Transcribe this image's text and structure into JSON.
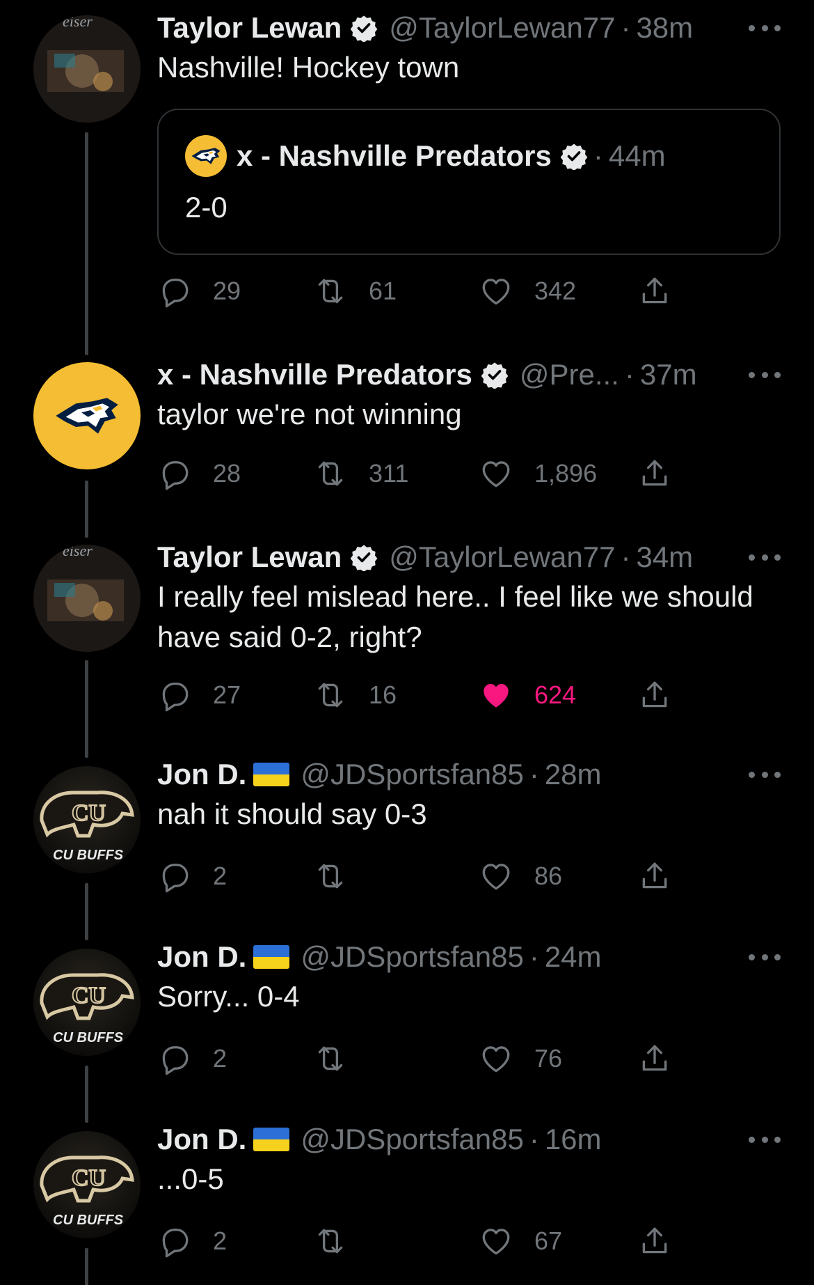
{
  "colors": {
    "background": "#000000",
    "text": "#e7e9ea",
    "muted": "#71767b",
    "like_active": "#f91880",
    "thread_line": "#3e4144",
    "verified": "#e7e9ea"
  },
  "tweets": [
    {
      "name": "Taylor Lewan",
      "handle": "@TaylorLewan77",
      "time": "38m",
      "text": "Nashville! Hockey town",
      "avatar_text": "eiser",
      "quote": {
        "name": "x - Nashville Predators",
        "time": "44m",
        "text": "2-0"
      },
      "replies": "29",
      "retweets": "61",
      "likes": "342",
      "liked": false
    },
    {
      "name": "x - Nashville Predators",
      "handle": "@Pre...",
      "time": "37m",
      "text": "taylor we're not winning",
      "replies": "28",
      "retweets": "311",
      "likes": "1,896",
      "liked": false
    },
    {
      "name": "Taylor Lewan",
      "handle": "@TaylorLewan77",
      "time": "34m",
      "text": "I really feel mislead here.. I feel like we should have said 0-2, right?",
      "avatar_text": "eiser",
      "replies": "27",
      "retweets": "16",
      "likes": "624",
      "liked": true
    },
    {
      "name": "Jon D.",
      "handle": "@JDSportsfan85",
      "time": "28m",
      "text": "nah it should say 0-3",
      "avatar_text": "CU BUFFS",
      "replies": "2",
      "retweets": "",
      "likes": "86",
      "liked": false
    },
    {
      "name": "Jon D.",
      "handle": "@JDSportsfan85",
      "time": "24m",
      "text": "Sorry... 0-4",
      "avatar_text": "CU BUFFS",
      "replies": "2",
      "retweets": "",
      "likes": "76",
      "liked": false
    },
    {
      "name": "Jon D.",
      "handle": "@JDSportsfan85",
      "time": "16m",
      "text": "...0-5",
      "avatar_text": "CU BUFFS",
      "replies": "2",
      "retweets": "",
      "likes": "67",
      "liked": false
    }
  ],
  "icons": {
    "verified": "verified-badge-icon",
    "more": "more-horizontal-icon",
    "reply": "reply-icon",
    "retweet": "retweet-icon",
    "like": "heart-icon",
    "share": "share-icon",
    "flag": "ukraine-flag-icon"
  }
}
